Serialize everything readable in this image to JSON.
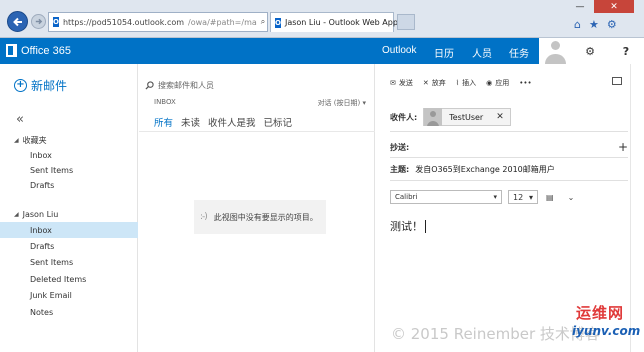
{
  "browser": {
    "url_host": "https://pod51054.outlook.com",
    "url_path": "/owa/#path=/ma",
    "tab_title": "Jason Liu - Outlook Web App",
    "favicon_letter": "O"
  },
  "suite": {
    "brand": "Office 365",
    "nav": [
      "Outlook",
      "日历",
      "人员",
      "任务"
    ],
    "settings_icon": "gear-icon",
    "help_label": "?"
  },
  "left_nav": {
    "new_mail": "新邮件",
    "collapse_glyph": "«",
    "favorites_label": "收藏夹",
    "favorites": [
      "Inbox",
      "Sent Items",
      "Drafts"
    ],
    "account_label": "Jason Liu",
    "folders": [
      "Inbox",
      "Drafts",
      "Sent Items",
      "Deleted Items",
      "Junk Email",
      "Notes"
    ],
    "selected": "Inbox"
  },
  "message_list": {
    "search_placeholder": "搜索邮件和人员",
    "folder_label": "INBOX",
    "sort_label": "对话 (按日期)",
    "filters": [
      "所有",
      "未读",
      "收件人是我",
      "已标记"
    ],
    "active_filter": "所有",
    "empty_text": "此视图中没有要显示的项目。",
    "empty_face": ":-)"
  },
  "compose": {
    "toolbar": {
      "send": "发送",
      "discard": "放弃",
      "insert": "插入",
      "apps": "应用",
      "more": "•••"
    },
    "to_label": "收件人:",
    "to_recipient": "TestUser",
    "cc_label": "抄送:",
    "subject_label": "主题:",
    "subject_value": "发自O365到Exchange 2010邮箱用户",
    "font_name": "Calibri",
    "font_size": "12",
    "body": "测试！"
  },
  "watermark": {
    "copyright": "© 2015 Reinember 技术博客",
    "brand_cn": "运维网",
    "brand_en": "iyunv.com"
  },
  "colors": {
    "suite_blue": "#0072c6",
    "selected_folder": "#cde6f7"
  }
}
